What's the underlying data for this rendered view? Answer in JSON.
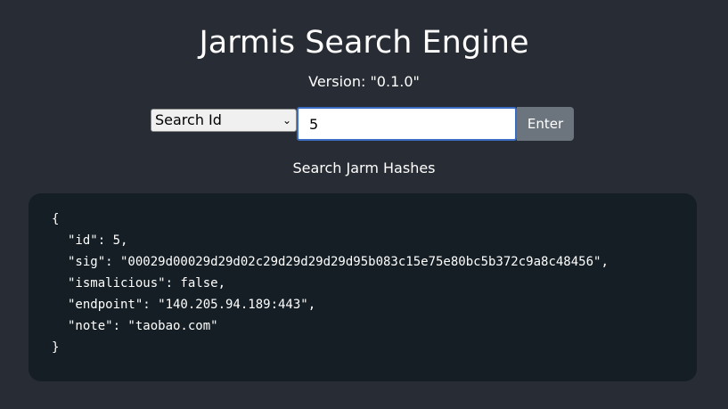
{
  "header": {
    "title": "Jarmis Search Engine",
    "version_text": "Version: \"0.1.0\""
  },
  "search": {
    "mode_selected": "Search Id",
    "input_value": "5",
    "enter_label": "Enter"
  },
  "subtitle": "Search Jarm Hashes",
  "result": {
    "open_brace": "{",
    "lines": [
      "\"id\": 5,",
      "\"sig\": \"00029d00029d29d02c29d29d29d29d95b083c15e75e80bc5b372c9a8c48456\",",
      "\"ismalicious\": false,",
      "\"endpoint\": \"140.205.94.189:443\",",
      "\"note\": \"taobao.com\""
    ],
    "close_brace": "}"
  }
}
